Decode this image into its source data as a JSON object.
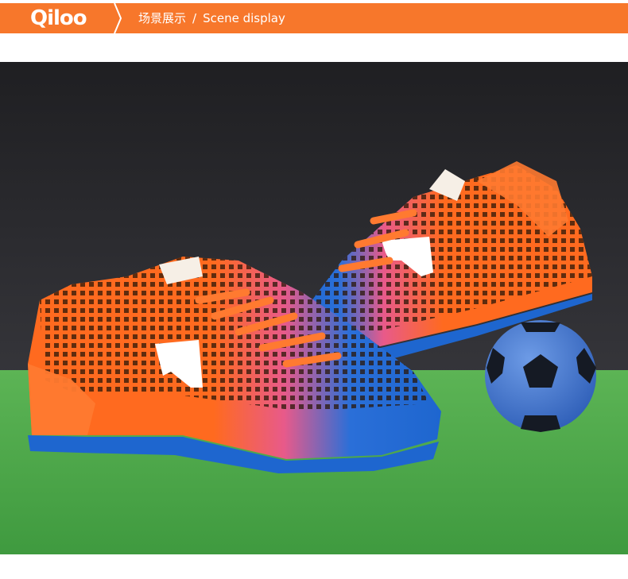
{
  "header": {
    "brand": "Qiloo",
    "title_cn": "场景展示",
    "separator": "/",
    "title_en": "Scene display"
  },
  "colors": {
    "accent": "#f7772b",
    "backdrop": "#2a2a2d",
    "turf": "#4fa84a",
    "shoe_orange": "#ff6a1f",
    "shoe_blue": "#1e73d6",
    "ball_blue": "#4a7fd8"
  },
  "photo": {
    "subject": "pair of orange and blue turf soccer shoes with a small soccer ball"
  }
}
